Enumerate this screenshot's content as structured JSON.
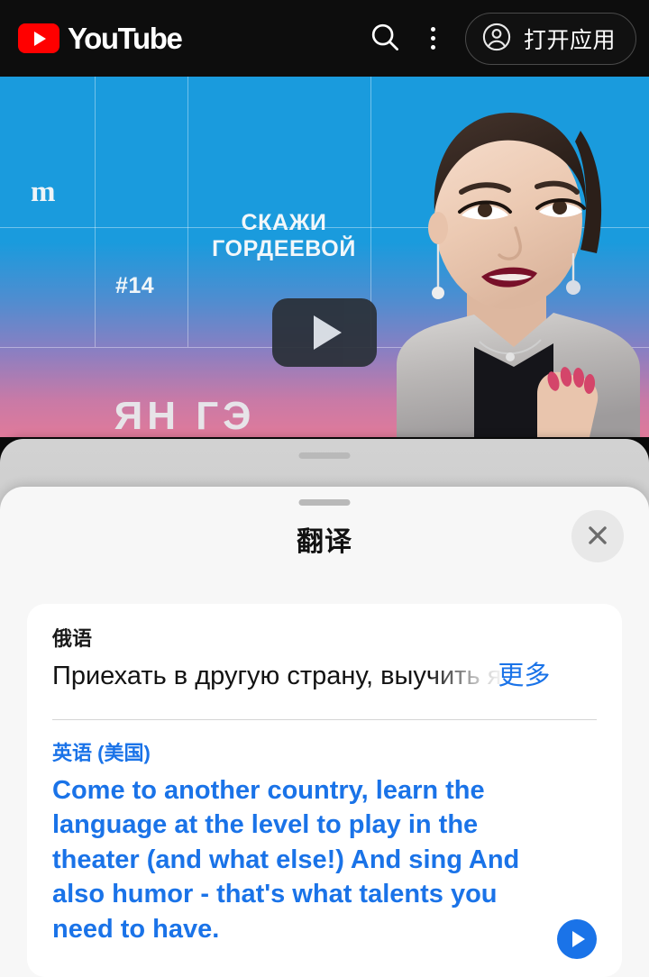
{
  "header": {
    "brand": "YouTube",
    "logo_icon": "youtube-play-logo",
    "search_icon": "search-icon",
    "more_icon": "kebab-menu-icon",
    "open_app": {
      "label": "打开应用",
      "icon": "account-circle-icon"
    },
    "background_color": "#0d0d0d",
    "brand_red": "#ff0000"
  },
  "video": {
    "play_overlay_icon": "play-triangle-icon",
    "overlay_title_line1": "СКАЖИ",
    "overlay_title_line2": "ГОРДЕЕВОЙ",
    "episode_number": "#14",
    "guest_name": "ЯН ГЭ",
    "channel_mark": "m",
    "thumbnail_top_color": "#1a9bdd",
    "thumbnail_bottom_color": "#e07a9a"
  },
  "sheet": {
    "grabber_icon": "drag-handle",
    "title": "翻译",
    "close_icon": "close-x-icon",
    "background_color": "#f7f7f7",
    "behind_sheet_color": "#cfcfcf"
  },
  "translation": {
    "source": {
      "language_label": "俄语",
      "text": "Приехать в другую страну, выучить я",
      "more_label": "更多"
    },
    "target": {
      "language_label": "英语 (美国)",
      "text": "Come to another country, learn the language at the level to play in the theater (and what else!) And sing And also humor - that's what talents you need to have.",
      "speak_icon": "play-audio-icon"
    },
    "accent_color": "#1a73e8"
  }
}
